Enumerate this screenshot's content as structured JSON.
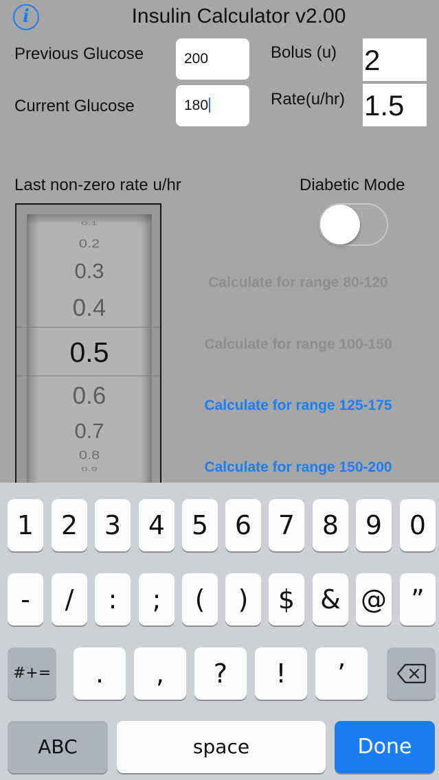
{
  "header": {
    "title": "Insulin Calculator v2.00",
    "info_glyph": "i"
  },
  "form": {
    "previous_glucose_label": "Previous Glucose",
    "previous_glucose_value": "200",
    "current_glucose_label": "Current Glucose",
    "current_glucose_value": "180",
    "bolus_label": "Bolus (u)",
    "bolus_value": "2",
    "rate_label": "Rate(u/hr)",
    "rate_value": "1.5"
  },
  "picker": {
    "label": "Last non-zero rate u/hr",
    "items": [
      "0.1",
      "0.2",
      "0.3",
      "0.4",
      "0.5",
      "0.6",
      "0.7",
      "0.8",
      "0.9"
    ],
    "selected": "0.5"
  },
  "diabetic_mode": {
    "label": "Diabetic Mode",
    "enabled": false
  },
  "actions": [
    {
      "label": "Calculate for range 80-120",
      "enabled": false
    },
    {
      "label": "Calculate for range 100-150",
      "enabled": false
    },
    {
      "label": "Calculate for range 125-175",
      "enabled": true
    },
    {
      "label": "Calculate for range 150-200",
      "enabled": true
    }
  ],
  "keyboard": {
    "row1": [
      "1",
      "2",
      "3",
      "4",
      "5",
      "6",
      "7",
      "8",
      "9",
      "0"
    ],
    "row2": [
      "-",
      "/",
      ":",
      ";",
      "(",
      ")",
      "$",
      "&",
      "@",
      "”"
    ],
    "row3_mode": "#+=",
    "row3": [
      ".",
      ",",
      "?",
      "!",
      "’"
    ],
    "abc": "ABC",
    "space": "space",
    "done": "Done"
  },
  "colors": {
    "accent": "#1a7ef2",
    "disabled_text": "#8d8d8d",
    "background": "#a6a6a6"
  },
  "icons": {
    "info": "info-icon",
    "backspace": "backspace-icon"
  }
}
